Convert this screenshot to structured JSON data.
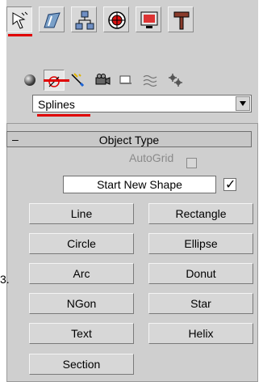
{
  "tabs": [
    {
      "name": "create",
      "icon": "create-arrow-icon",
      "active": true
    },
    {
      "name": "modify",
      "icon": "modify-icon",
      "active": false
    },
    {
      "name": "hierarchy",
      "icon": "hierarchy-icon",
      "active": false
    },
    {
      "name": "motion",
      "icon": "motion-icon",
      "active": false
    },
    {
      "name": "display",
      "icon": "display-icon",
      "active": false
    },
    {
      "name": "utilities",
      "icon": "hammer-icon",
      "active": false
    }
  ],
  "categories": [
    {
      "name": "geometry",
      "icon": "sphere-icon"
    },
    {
      "name": "shapes",
      "icon": "shapes-icon",
      "active": true
    },
    {
      "name": "lights",
      "icon": "light-icon"
    },
    {
      "name": "cameras",
      "icon": "camera-icon"
    },
    {
      "name": "helpers",
      "icon": "helper-icon"
    },
    {
      "name": "space-warps",
      "icon": "spacewarp-icon"
    },
    {
      "name": "systems",
      "icon": "system-gear-icon"
    }
  ],
  "dropdown": {
    "value": "Splines"
  },
  "rollout": {
    "title": "Object Type",
    "collapse": "–"
  },
  "autogrid": {
    "label": "AutoGrid",
    "checked": false
  },
  "start_new_shape": {
    "label": "Start New Shape",
    "checked": true
  },
  "buttons": [
    [
      "Line",
      "Rectangle"
    ],
    [
      "Circle",
      "Ellipse"
    ],
    [
      "Arc",
      "Donut"
    ],
    [
      "NGon",
      "Star"
    ],
    [
      "Text",
      "Helix"
    ],
    [
      "Section"
    ]
  ],
  "left_fragment": "3.",
  "colors": {
    "highlight": "#e00000",
    "panel": "#cfcfcf"
  }
}
